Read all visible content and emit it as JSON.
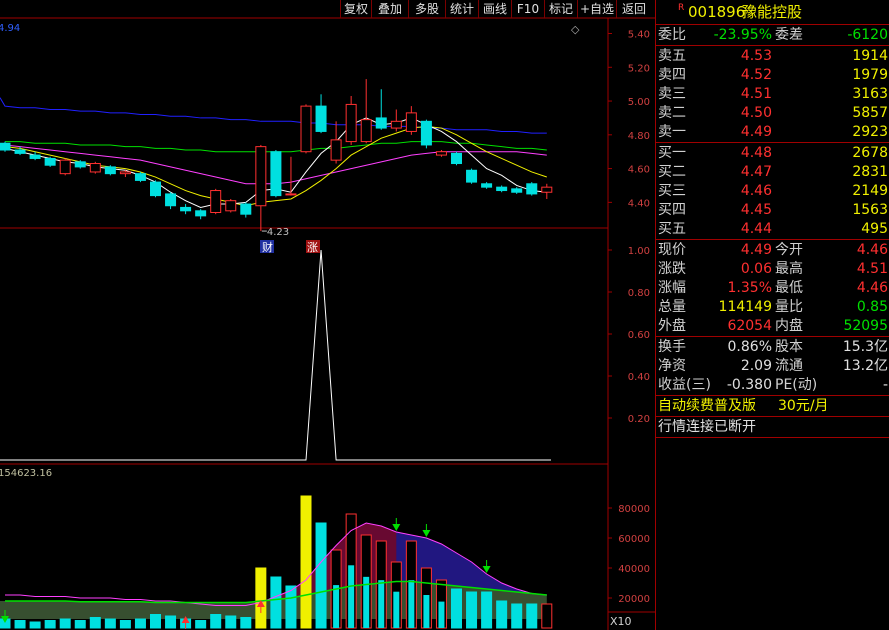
{
  "toolbar": {
    "buttons": [
      "复权",
      "叠加",
      "多股",
      "统计",
      "画线",
      "F10",
      "标记",
      "+自选",
      "返回"
    ]
  },
  "stock": {
    "badge": "R",
    "code": "001896",
    "name": "豫能控股"
  },
  "main_chart": {
    "top_left_value": "4.94",
    "low_annotation": "4.23",
    "cai_label": "财",
    "zhang_label": "涨",
    "y_ticks": [
      "5.40",
      "5.20",
      "5.00",
      "4.80",
      "4.60",
      "4.40"
    ]
  },
  "indicator_chart": {
    "y_ticks": [
      "1.00",
      "0.80",
      "0.60",
      "0.40",
      "0.20"
    ]
  },
  "volume_chart": {
    "top_left_value": "154623.16",
    "y_ticks": [
      "80000",
      "60000",
      "40000",
      "20000"
    ],
    "unit": "X10"
  },
  "quote": {
    "weibi_label": "委比",
    "weibi": "-23.95%",
    "weicha_label": "委差",
    "weicha": "-6120",
    "sell": [
      {
        "label": "卖五",
        "price": "4.53",
        "vol": "1914"
      },
      {
        "label": "卖四",
        "price": "4.52",
        "vol": "1979"
      },
      {
        "label": "卖三",
        "price": "4.51",
        "vol": "3163"
      },
      {
        "label": "卖二",
        "price": "4.50",
        "vol": "5857"
      },
      {
        "label": "卖一",
        "price": "4.49",
        "vol": "2923"
      }
    ],
    "buy": [
      {
        "label": "买一",
        "price": "4.48",
        "vol": "2678"
      },
      {
        "label": "买二",
        "price": "4.47",
        "vol": "2831"
      },
      {
        "label": "买三",
        "price": "4.46",
        "vol": "2149"
      },
      {
        "label": "买四",
        "price": "4.45",
        "vol": "1563"
      },
      {
        "label": "买五",
        "price": "4.44",
        "vol": "495"
      }
    ],
    "stats1": [
      {
        "l1": "现价",
        "v1": "4.49",
        "l2": "今开",
        "v2": "4.46"
      },
      {
        "l1": "涨跌",
        "v1": "0.06",
        "l2": "最高",
        "v2": "4.51"
      },
      {
        "l1": "涨幅",
        "v1": "1.35%",
        "l2": "最低",
        "v2": "4.46"
      },
      {
        "l1": "总量",
        "v1": "114149",
        "l2": "量比",
        "v2": "0.85"
      },
      {
        "l1": "外盘",
        "v1": "62054",
        "l2": "内盘",
        "v2": "52095"
      }
    ],
    "stats2": [
      {
        "l1": "换手",
        "v1": "0.86%",
        "l2": "股本",
        "v2": "15.3亿"
      },
      {
        "l1": "净资",
        "v1": "2.09",
        "l2": "流通",
        "v2": "13.2亿"
      },
      {
        "l1": "收益(三)",
        "v1": "-0.380",
        "l2": "PE(动)",
        "v2": "-"
      }
    ],
    "promo_text": "自动续费普及版",
    "promo_price": "30元/月",
    "status_text": "行情连接已断开"
  },
  "colors": {
    "up": "#ff3030",
    "down": "#00e0e0",
    "ma5": "#ffffff",
    "ma10": "#f0f000",
    "ma20": "#ff40ff",
    "ma30": "#00e000",
    "ma60": "#2020ff",
    "grid": "#a00000"
  },
  "chart_data": {
    "type": "candlestick",
    "candles": [
      {
        "o": 4.75,
        "c": 4.71,
        "h": 4.76,
        "l": 4.7
      },
      {
        "o": 4.71,
        "c": 4.69,
        "h": 4.73,
        "l": 4.68
      },
      {
        "o": 4.68,
        "c": 4.66,
        "h": 4.7,
        "l": 4.65
      },
      {
        "o": 4.66,
        "c": 4.62,
        "h": 4.67,
        "l": 4.61
      },
      {
        "o": 4.57,
        "c": 4.65,
        "h": 4.66,
        "l": 4.56
      },
      {
        "o": 4.64,
        "c": 4.61,
        "h": 4.65,
        "l": 4.6
      },
      {
        "o": 4.58,
        "c": 4.63,
        "h": 4.64,
        "l": 4.57
      },
      {
        "o": 4.61,
        "c": 4.57,
        "h": 4.62,
        "l": 4.56
      },
      {
        "o": 4.57,
        "c": 4.58,
        "h": 4.59,
        "l": 4.55
      },
      {
        "o": 4.57,
        "c": 4.53,
        "h": 4.58,
        "l": 4.52
      },
      {
        "o": 4.52,
        "c": 4.44,
        "h": 4.53,
        "l": 4.43
      },
      {
        "o": 4.45,
        "c": 4.38,
        "h": 4.46,
        "l": 4.36
      },
      {
        "o": 4.37,
        "c": 4.35,
        "h": 4.39,
        "l": 4.33
      },
      {
        "o": 4.35,
        "c": 4.32,
        "h": 4.36,
        "l": 4.3
      },
      {
        "o": 4.34,
        "c": 4.47,
        "h": 4.48,
        "l": 4.33
      },
      {
        "o": 4.35,
        "c": 4.41,
        "h": 4.42,
        "l": 4.34
      },
      {
        "o": 4.39,
        "c": 4.33,
        "h": 4.4,
        "l": 4.31
      },
      {
        "o": 4.38,
        "c": 4.73,
        "h": 4.74,
        "l": 4.23
      },
      {
        "o": 4.7,
        "c": 4.44,
        "h": 4.71,
        "l": 4.43
      },
      {
        "o": 4.45,
        "c": 4.45,
        "h": 4.67,
        "l": 4.44
      },
      {
        "o": 4.7,
        "c": 4.97,
        "h": 4.98,
        "l": 4.69
      },
      {
        "o": 4.97,
        "c": 4.82,
        "h": 5.04,
        "l": 4.81
      },
      {
        "o": 4.65,
        "c": 4.77,
        "h": 4.88,
        "l": 4.63
      },
      {
        "o": 4.76,
        "c": 4.98,
        "h": 5.03,
        "l": 4.74
      },
      {
        "o": 4.76,
        "c": 4.89,
        "h": 5.13,
        "l": 4.75
      },
      {
        "o": 4.9,
        "c": 4.84,
        "h": 5.07,
        "l": 4.83
      },
      {
        "o": 4.84,
        "c": 4.88,
        "h": 4.95,
        "l": 4.82
      },
      {
        "o": 4.82,
        "c": 4.93,
        "h": 4.97,
        "l": 4.8
      },
      {
        "o": 4.88,
        "c": 4.74,
        "h": 4.89,
        "l": 4.72
      },
      {
        "o": 4.68,
        "c": 4.7,
        "h": 4.71,
        "l": 4.67
      },
      {
        "o": 4.69,
        "c": 4.63,
        "h": 4.7,
        "l": 4.62
      },
      {
        "o": 4.59,
        "c": 4.52,
        "h": 4.6,
        "l": 4.51
      },
      {
        "o": 4.51,
        "c": 4.49,
        "h": 4.52,
        "l": 4.48
      },
      {
        "o": 4.49,
        "c": 4.47,
        "h": 4.5,
        "l": 4.46
      },
      {
        "o": 4.48,
        "c": 4.46,
        "h": 4.49,
        "l": 4.45
      },
      {
        "o": 4.51,
        "c": 4.45,
        "h": 4.52,
        "l": 4.44
      },
      {
        "o": 4.46,
        "c": 4.49,
        "h": 4.51,
        "l": 4.42
      }
    ],
    "ma60": [
      4.97,
      4.96,
      4.96,
      4.95,
      4.95,
      4.94,
      4.94,
      4.93,
      4.93,
      4.92,
      4.92,
      4.91,
      4.91,
      4.9,
      4.9,
      4.89,
      4.89,
      4.88,
      4.88,
      4.88,
      4.87,
      4.87,
      4.86,
      4.86,
      4.86,
      4.85,
      4.85,
      4.85,
      4.84,
      4.84,
      4.83,
      4.83,
      4.83,
      4.82,
      4.82,
      4.81,
      4.81
    ],
    "ma30": [
      4.76,
      4.76,
      4.75,
      4.75,
      4.75,
      4.74,
      4.74,
      4.74,
      4.73,
      4.73,
      4.72,
      4.72,
      4.71,
      4.71,
      4.7,
      4.7,
      4.7,
      4.7,
      4.7,
      4.7,
      4.71,
      4.72,
      4.72,
      4.73,
      4.74,
      4.75,
      4.75,
      4.76,
      4.76,
      4.76,
      4.75,
      4.75,
      4.74,
      4.73,
      4.72,
      4.72,
      4.71
    ],
    "ma20": [
      4.74,
      4.73,
      4.72,
      4.71,
      4.7,
      4.69,
      4.68,
      4.67,
      4.66,
      4.65,
      4.63,
      4.61,
      4.59,
      4.57,
      4.55,
      4.53,
      4.51,
      4.51,
      4.51,
      4.52,
      4.54,
      4.56,
      4.58,
      4.6,
      4.62,
      4.64,
      4.66,
      4.68,
      4.69,
      4.7,
      4.7,
      4.7,
      4.7,
      4.7,
      4.7,
      4.69,
      4.68
    ],
    "ma10": [
      4.73,
      4.72,
      4.7,
      4.68,
      4.66,
      4.64,
      4.62,
      4.61,
      4.6,
      4.58,
      4.55,
      4.51,
      4.47,
      4.44,
      4.42,
      4.4,
      4.38,
      4.4,
      4.41,
      4.42,
      4.47,
      4.53,
      4.6,
      4.68,
      4.73,
      4.78,
      4.81,
      4.84,
      4.85,
      4.84,
      4.8,
      4.75,
      4.7,
      4.66,
      4.62,
      4.58,
      4.55
    ],
    "ma5": [
      4.72,
      4.7,
      4.68,
      4.66,
      4.64,
      4.63,
      4.61,
      4.6,
      4.59,
      4.56,
      4.52,
      4.46,
      4.41,
      4.37,
      4.39,
      4.39,
      4.4,
      4.47,
      4.48,
      4.46,
      4.58,
      4.69,
      4.76,
      4.86,
      4.9,
      4.86,
      4.87,
      4.9,
      4.86,
      4.82,
      4.76,
      4.68,
      4.6,
      4.56,
      4.5,
      4.47,
      4.46
    ],
    "indicator": [
      0,
      0,
      0,
      0,
      0,
      0,
      0,
      0,
      0,
      0,
      0,
      0,
      0,
      0,
      0,
      0,
      0,
      0,
      0,
      0,
      0,
      1,
      0,
      0,
      0,
      0,
      0,
      0,
      0,
      0,
      0,
      0,
      0,
      0,
      0,
      0,
      0
    ],
    "volume": [
      6000,
      5000,
      4000,
      5000,
      6000,
      5000,
      7000,
      6000,
      5000,
      6000,
      9000,
      8000,
      6000,
      5000,
      9000,
      8000,
      7000,
      40000,
      34000,
      28000,
      88000,
      70000,
      52000,
      76000,
      62000,
      58000,
      44000,
      58000,
      40000,
      32000,
      26000,
      24000,
      24000,
      18000,
      16000,
      16000,
      16000
    ],
    "vol_overlay": {
      "yellow_bars": [
        17,
        20
      ],
      "red_outline_bars": [
        22,
        23,
        24,
        25,
        26,
        27,
        28,
        29,
        36
      ]
    },
    "vol_ma_fast": [
      22000,
      22000,
      21000,
      21000,
      21000,
      20000,
      20000,
      20000,
      19000,
      19000,
      18000,
      18000,
      17000,
      16000,
      15000,
      15000,
      15000,
      17000,
      21000,
      25000,
      32000,
      44000,
      55000,
      65000,
      70000,
      68000,
      64000,
      62000,
      60000,
      56000,
      50000,
      44000,
      36000,
      30000,
      26000,
      23000,
      22000
    ],
    "vol_ma_slow": [
      18000,
      18000,
      18000,
      18000,
      18000,
      17500,
      17500,
      17500,
      17500,
      17500,
      17000,
      17000,
      17000,
      17000,
      17000,
      17000,
      17000,
      18000,
      19000,
      20000,
      22000,
      24000,
      26000,
      28000,
      29000,
      30000,
      31000,
      31000,
      30000,
      29000,
      28000,
      27000,
      26000,
      25000,
      24000,
      23000,
      22000
    ]
  }
}
